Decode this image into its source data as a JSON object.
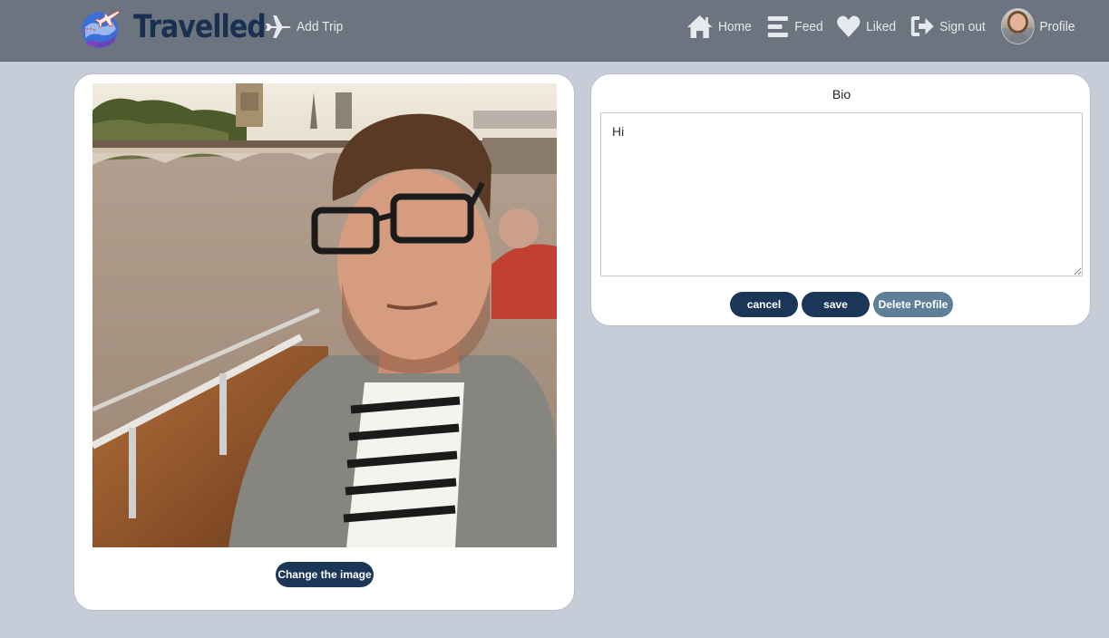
{
  "app": {
    "brand": "Travelled"
  },
  "nav": {
    "add_trip": "Add Trip",
    "home": "Home",
    "feed": "Feed",
    "liked": "Liked",
    "sign_out": "Sign out",
    "profile": "Profile"
  },
  "profile_card": {
    "change_image_label": "Change the image"
  },
  "bio_card": {
    "title": "Bio",
    "bio_value": "Hi",
    "cancel_label": "cancel",
    "save_label": "save",
    "delete_label": "Delete Profile"
  },
  "colors": {
    "navbar": "#6b747f",
    "page_background": "#c6ccd8",
    "brand": "#1a3050",
    "button_primary": "#1c3658",
    "button_delete": "#5e7f98"
  },
  "icons": {
    "logo": "globe-plane-logo-icon",
    "add_trip": "airplane-icon",
    "home": "home-icon",
    "feed": "menu-lines-icon",
    "liked": "heart-icon",
    "sign_out": "sign-out-icon"
  }
}
